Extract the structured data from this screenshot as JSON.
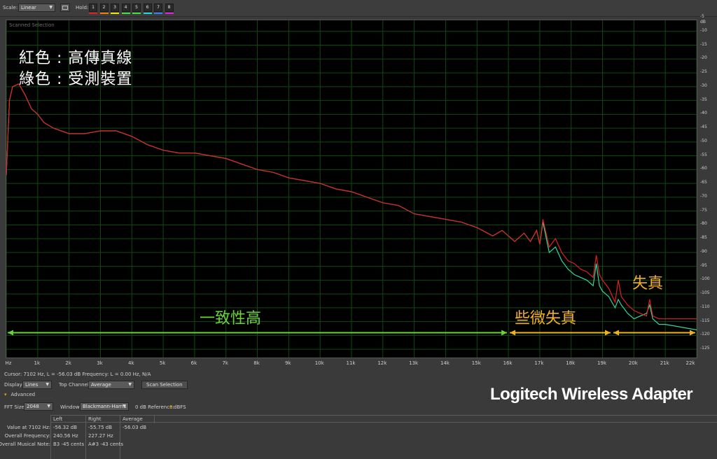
{
  "toolbar": {
    "scale_label": "Scale:",
    "scale_value": "Linear",
    "hold_label": "Hold:",
    "hold_buttons": [
      {
        "label": "1",
        "color": "#e02020"
      },
      {
        "label": "2",
        "color": "#f08000"
      },
      {
        "label": "3",
        "color": "#e8e800"
      },
      {
        "label": "4",
        "color": "#40e040"
      },
      {
        "label": "5",
        "color": "#40e040"
      },
      {
        "label": "6",
        "color": "#20d8d8"
      },
      {
        "label": "7",
        "color": "#3080ff"
      },
      {
        "label": "8",
        "color": "#e020e0"
      }
    ]
  },
  "panel": {
    "title": "Scanned Selection",
    "legend_line1": "紅色 : 高傳真線",
    "legend_line2": "綠色 : 受測裝置",
    "annotation_consistent": "一致性高",
    "annotation_slight": "些微失真",
    "annotation_distortion": "失真"
  },
  "chart_data": {
    "type": "line",
    "xlabel": "Hz",
    "ylabel": "dB",
    "xlim": [
      0,
      22000
    ],
    "ylim": [
      -128,
      -6
    ],
    "x_ticks": [
      "Hz",
      "1k",
      "2k",
      "3k",
      "4k",
      "5k",
      "6k",
      "7k",
      "8k",
      "9k",
      "10k",
      "11k",
      "12k",
      "13k",
      "14k",
      "15k",
      "16k",
      "17k",
      "18k",
      "19k",
      "20k",
      "21k",
      "22k"
    ],
    "y_ticks": [
      "dB",
      "-5",
      "-10",
      "-15",
      "-20",
      "-25",
      "-30",
      "-35",
      "-40",
      "-45",
      "-50",
      "-55",
      "-60",
      "-65",
      "-70",
      "-75",
      "-80",
      "-85",
      "-90",
      "-95",
      "-100",
      "-105",
      "-110",
      "-115",
      "-120",
      "-125"
    ],
    "colors": {
      "reference": "#e02020",
      "device": "#30d8a0",
      "grid": "#0f4a0f",
      "arrow_green": "#6ccf3c",
      "arrow_orange": "#f0b020"
    },
    "series": [
      {
        "color": "red",
        "x": [
          0,
          100,
          200,
          400,
          600,
          800,
          1000,
          1200,
          1500,
          2000,
          2500,
          3000,
          3500,
          4000,
          4500,
          5000,
          5500,
          6000,
          6500,
          7000,
          7500,
          8000,
          8500,
          9000,
          9500,
          10000,
          10500,
          11000,
          11500,
          12000,
          12500,
          13000,
          13500,
          14000,
          14500,
          15000,
          15500,
          15800,
          16000,
          16200,
          16500,
          16700,
          16900,
          17000,
          17100,
          17300,
          17500,
          17700,
          17900,
          18100,
          18300,
          18500,
          18700,
          18800,
          18900,
          19000,
          19200,
          19400,
          19500,
          19600,
          19800,
          20000,
          20200,
          20400,
          20500,
          20600,
          20800,
          21000,
          21500,
          22000
        ],
        "y": [
          -62,
          -35,
          -30,
          -29,
          -33,
          -38,
          -40,
          -43,
          -45,
          -47,
          -47,
          -46,
          -46,
          -48,
          -51,
          -53,
          -54,
          -54,
          -55,
          -56,
          -58,
          -60,
          -61,
          -63,
          -64,
          -65,
          -67,
          -68,
          -70,
          -72,
          -73,
          -76,
          -77,
          -78,
          -79,
          -81,
          -84,
          -82,
          -84,
          -86,
          -83,
          -86,
          -82,
          -87,
          -78,
          -88,
          -85,
          -90,
          -93,
          -94,
          -96,
          -97,
          -99,
          -91,
          -98,
          -100,
          -103,
          -108,
          -100,
          -106,
          -109,
          -111,
          -112,
          -113,
          -107,
          -113,
          -114,
          -114,
          -114,
          -114
        ]
      },
      {
        "color": "green",
        "x": [
          0,
          100,
          200,
          400,
          600,
          800,
          1000,
          1200,
          1500,
          2000,
          2500,
          3000,
          3500,
          4000,
          4500,
          5000,
          5500,
          6000,
          6500,
          7000,
          7500,
          8000,
          8500,
          9000,
          9500,
          10000,
          10500,
          11000,
          11500,
          12000,
          12500,
          13000,
          13500,
          14000,
          14500,
          15000,
          15500,
          15800,
          16000,
          16200,
          16500,
          16700,
          16900,
          17000,
          17100,
          17300,
          17500,
          17700,
          17900,
          18100,
          18300,
          18500,
          18700,
          18800,
          18900,
          19000,
          19200,
          19400,
          19500,
          19600,
          19800,
          20000,
          20200,
          20400,
          20500,
          20600,
          20800,
          21000,
          21500,
          22000
        ],
        "y": [
          -62,
          -35,
          -30,
          -29,
          -33,
          -38,
          -40,
          -43,
          -45,
          -47,
          -47,
          -46,
          -46,
          -48,
          -51,
          -53,
          -54,
          -54,
          -55,
          -56,
          -58,
          -60,
          -61,
          -63,
          -64,
          -65,
          -67,
          -68,
          -70,
          -72,
          -73,
          -76,
          -77,
          -78,
          -79,
          -81,
          -84,
          -82,
          -84,
          -86,
          -83,
          -86,
          -82,
          -87,
          -79,
          -90,
          -88,
          -93,
          -96,
          -98,
          -99,
          -100,
          -102,
          -94,
          -102,
          -104,
          -106,
          -110,
          -107,
          -109,
          -112,
          -114,
          -113,
          -112,
          -109,
          -114,
          -116,
          -116,
          -117,
          -118
        ]
      }
    ],
    "arrows": [
      {
        "from": 0,
        "to": 16000,
        "color": "green"
      },
      {
        "from": 16000,
        "to": 19300,
        "color": "orange"
      },
      {
        "from": 19300,
        "to": 22000,
        "color": "orange"
      }
    ]
  },
  "status": {
    "cursor_text": "Cursor: 7102 Hz, L = -56.03 dB  Frequency: L = 0.00 Hz, N/A"
  },
  "controls": {
    "display_label": "Display:",
    "display_value": "Lines",
    "top_channel_label": "Top Channel:",
    "top_channel_value": "Average",
    "scan_button": "Scan Selection",
    "advanced_label": "Advanced",
    "fft_label": "FFT Size:",
    "fft_value": "2048",
    "window_label": "Window:",
    "window_value": "Blackmann-Harris",
    "zero_db_label": "0 dB Reference:",
    "zero_db_value": "0",
    "zero_db_unit": "dBFS"
  },
  "brand": "Logitech Wireless Adapter",
  "table": {
    "headers": [
      "Left",
      "Right",
      "Average"
    ],
    "rows": [
      {
        "label": "Value at 7102 Hz:",
        "cells": [
          "-56.32 dB",
          "-55.75 dB",
          "-56.03 dB"
        ]
      },
      {
        "label": "Overall Frequency:",
        "cells": [
          "240.56 Hz",
          "227.27 Hz",
          ""
        ]
      },
      {
        "label": "Overall Musical Note:",
        "cells": [
          "B3 -45 cents",
          "A#3 -43 cents",
          ""
        ]
      }
    ]
  }
}
